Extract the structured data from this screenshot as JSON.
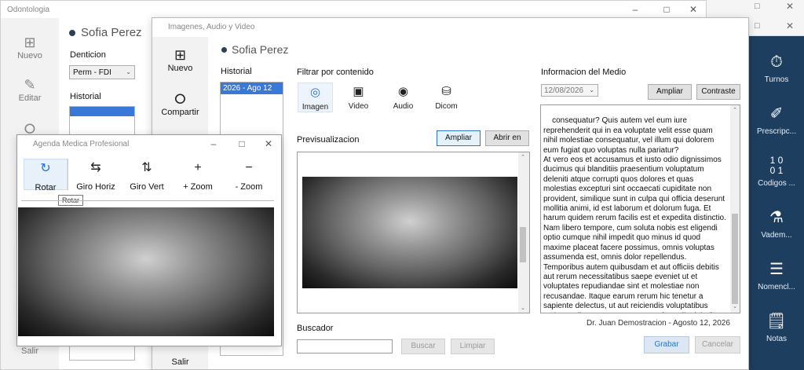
{
  "bg_window": {
    "title": "Odontologia",
    "patient": "Sofia Perez",
    "sidebar": [
      {
        "label": "Nuevo",
        "icon": "plus-square-icon"
      },
      {
        "label": "Editar",
        "icon": "edit-icon"
      }
    ],
    "salir_label": "Salir",
    "denticion_label": "Denticion",
    "denticion_value": "Perm - FDI",
    "historial_label": "Historial"
  },
  "media_window": {
    "title": "Imagenes, Audio y Video",
    "patient": "Sofia Perez",
    "sidebar": [
      {
        "label": "Nuevo",
        "icon": "plus-square-icon"
      },
      {
        "label": "Compartir",
        "icon": "share-icon"
      }
    ],
    "salir_label": "Salir",
    "historial_label": "Historial",
    "historial_items": [
      "2026 - Ago 12"
    ],
    "filter_label": "Filtrar por contenido",
    "filter_tabs": [
      {
        "label": "Imagen",
        "icon": "camera-icon",
        "active": true
      },
      {
        "label": "Video",
        "icon": "video-icon",
        "active": false
      },
      {
        "label": "Audio",
        "icon": "broadcast-icon",
        "active": false
      },
      {
        "label": "Dicom",
        "icon": "dicom-icon",
        "active": false
      }
    ],
    "preview_label": "Previsualizacion",
    "ampliar_label": "Ampliar",
    "abrir_label": "Abrir en",
    "info_label": "Informacion del Medio",
    "date_value": "12/08/2026",
    "ampliar2_label": "Ampliar",
    "contraste_label": "Contraste",
    "notes_text": "consequatur? Quis autem vel eum iure reprehenderit qui in ea voluptate velit esse quam nihil molestiae consequatur, vel illum qui dolorem eum fugiat quo voluptas nulla pariatur?\nAt vero eos et accusamus et iusto odio dignissimos ducimus qui blanditiis praesentium voluptatum deleniti atque corrupti quos dolores et quas molestias excepturi sint occaecati cupiditate non provident, similique sunt in culpa qui officia deserunt mollitia animi, id est laborum et dolorum fuga. Et harum quidem rerum facilis est et expedita distinctio. Nam libero tempore, cum soluta nobis est eligendi optio cumque nihil impedit quo minus id quod maxime placeat facere possimus, omnis voluptas assumenda est, omnis dolor repellendus. Temporibus autem quibusdam et aut officiis debitis aut rerum necessitatibus saepe eveniet ut et voluptates repudiandae sint et molestiae non recusandae. Itaque earum rerum hic tenetur a sapiente delectus, ut aut reiciendis voluptatibus maiores alias consequatur aut perferendis doloribus asperiores repellat.",
    "signature": "Dr. Juan Demostracion - Agosto 12, 2026",
    "buscador_label": "Buscador",
    "buscar_label": "Buscar",
    "limpiar_label": "Limpiar",
    "grabar_label": "Grabar",
    "cancelar_label": "Cancelar"
  },
  "agenda_window": {
    "title": "Agenda Medica Profesional",
    "tools": [
      {
        "label": "Rotar",
        "icon": "rotate-icon"
      },
      {
        "label": "Giro Horiz",
        "icon": "flip-horizontal-icon"
      },
      {
        "label": "Giro Vert",
        "icon": "flip-vertical-icon"
      },
      {
        "label": "+ Zoom",
        "icon": "zoom-in-icon"
      },
      {
        "label": "- Zoom",
        "icon": "zoom-out-icon"
      }
    ],
    "tooltip": "Rotar"
  },
  "right_rail": {
    "items": [
      {
        "label": "Turnos",
        "icon": "clock-icon"
      },
      {
        "label": "Prescripc...",
        "icon": "prescription-icon"
      },
      {
        "label": "Codigos ...",
        "icon": "binary-icon"
      },
      {
        "label": "Vadem...",
        "icon": "flask-icon"
      },
      {
        "label": "Nomencl...",
        "icon": "list-icon"
      },
      {
        "label": "Notas",
        "icon": "notes-icon"
      }
    ]
  },
  "colors": {
    "rail_bg": "#1d3e5e",
    "selection": "#3a78d8",
    "active_tab": "#2c74c9"
  }
}
